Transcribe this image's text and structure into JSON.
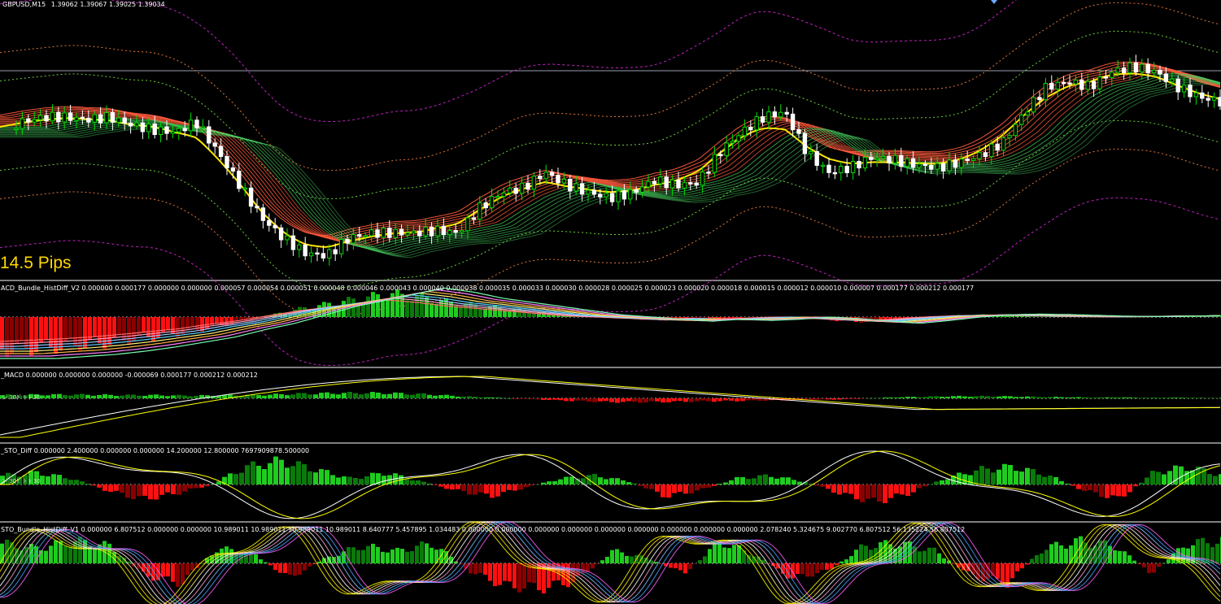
{
  "window": {
    "symbol_header": "GBPUSD,M15",
    "ohlc": "1.39062 1.39067 1.39025 1.39034",
    "pips_label": "14.5 Pips"
  },
  "panes": {
    "p1": {
      "header": "ACD_Bundle_HistDiff_V2 0.000000 0.000177 0.000000 0.000000 0.000057 0.000054 0.000051 0.000048 0.000046 0.000043 0.000040 0.000038 0.000035 0.000033 0.000030 0.000028 0.000025 0.000023 0.000020 0.000018 0.000015 0.000012 0.000010 0.000007 0.000177 0.000212 0.000177"
    },
    "p2": {
      "header": "_MACD 0.000000 0.000000 0.000000 -0.000069 0.000177 0.000212 0.000212",
      "level_text": "ン 30ｸﾞ ﾄ ﾄ 30"
    },
    "p3": {
      "header": "_STO_Diff 0.000000 2.400000 0.000000 0.000000 14.200000 12.800000 7697909878.500000",
      "level_text": "ン 30ｸﾞ ﾄ ﾄ 30"
    },
    "p4": {
      "header": "STO_Bundle_HistDiff_V1 0.000000 6.807512 0.000000 0.000000 10.989011 10.989011 10.989011 10.989011 8.640777 5.457895 1.034483 0.000000 0.000000 0.000000 0.000000 0.000000 0.000000 0.000000 0.000000 0.000000 2.078240 5.324675 9.002770 6.807512 56.135224 56.807512"
    }
  },
  "colors": {
    "bull_candle": "#00e000",
    "bear_candle": "#ffffff",
    "bundle_a": "#ff5a3c",
    "bundle_b": "#4cd964",
    "bundle_yellow": "#ffe600",
    "band_outer": "#c020c0",
    "band_mid": "#e0783c",
    "band_inner": "#6ccf3c",
    "hist_pos": "#1fcc1f",
    "hist_pos_dark": "#0a7a0a",
    "hist_neg": "#ff1010",
    "hist_neg_dark": "#8a0000",
    "macd_line": "#ffffff",
    "signal_line": "#ffff00",
    "separator": "#808080"
  },
  "chart_data": [
    {
      "type": "line",
      "pane": "price",
      "title": "GBPUSD,M15",
      "description_series": [
        {
          "values": [
            0.55,
            0.58,
            0.6,
            0.6,
            0.59,
            0.6,
            0.57,
            0.55,
            0.54,
            0.58,
            0.46,
            0.33,
            0.2,
            0.12,
            0.06,
            0.05,
            0.12,
            0.14,
            0.14,
            0.14,
            0.15,
            0.14,
            0.24,
            0.3,
            0.32,
            0.38,
            0.33,
            0.3,
            0.28,
            0.3,
            0.35,
            0.33,
            0.34,
            0.46,
            0.54,
            0.6,
            0.62,
            0.46,
            0.38,
            0.4,
            0.44,
            0.43,
            0.41,
            0.4,
            0.42,
            0.45,
            0.5,
            0.62,
            0.72,
            0.74,
            0.72,
            0.78,
            0.8,
            0.78,
            0.72,
            0.68,
            0.66
          ]
        }
      ]
    },
    {
      "type": "bar",
      "pane": "macd_bundle",
      "values": [
        -1,
        -0.95,
        -0.9,
        -0.82,
        -0.72,
        -0.6,
        -0.48,
        -0.3,
        -0.15,
        0.05,
        0.25,
        0.4,
        0.55,
        0.7,
        0.6,
        0.45,
        0.35,
        0.25,
        0.15,
        0.05,
        0.0,
        -0.05,
        -0.1,
        -0.05,
        -0.08,
        -0.05,
        0.0,
        -0.04,
        -0.1,
        -0.15,
        -0.08,
        0.0,
        0.05,
        0.07,
        0.06,
        0.04,
        0.02,
        0.01,
        0.02,
        0.03,
        0.04,
        0.05
      ]
    },
    {
      "type": "bar",
      "pane": "macd",
      "values": [
        0.3,
        0.35,
        0.35,
        0.3,
        0.3,
        0.25,
        0.3,
        0.35,
        0.45,
        0.5,
        0.5,
        0.4,
        0.2,
        0.05,
        -0.1,
        -0.25,
        -0.35,
        -0.35,
        -0.3,
        -0.25,
        -0.2,
        -0.15,
        -0.1,
        0.05,
        0.15,
        0.2,
        0.2,
        0.15,
        0.1,
        0.08,
        0.06,
        0.05,
        0.04
      ]
    },
    {
      "type": "bar",
      "pane": "sto_diff",
      "values": [
        0.3,
        0.4,
        0.2,
        -0.2,
        -0.5,
        -0.3,
        0.0,
        0.6,
        0.8,
        0.5,
        0.2,
        0.4,
        0.1,
        -0.2,
        -0.4,
        -0.1,
        0.2,
        0.3,
        0.1,
        -0.4,
        -0.2,
        0.2,
        0.3,
        0.1,
        -0.3,
        -0.6,
        -0.3,
        0.2,
        0.5,
        0.6,
        0.3,
        -0.2,
        -0.5,
        0.4,
        0.6,
        0.3
      ]
    },
    {
      "type": "bar",
      "pane": "sto_bundle",
      "values": [
        0.8,
        0.6,
        0.9,
        0.7,
        -0.5,
        -0.8,
        0.6,
        0.4,
        -0.6,
        0.2,
        0.7,
        0.5,
        0.8,
        -0.3,
        -0.9,
        -1,
        -0.7,
        0.5,
        0.2,
        -0.4,
        0.9,
        0.3,
        -0.6,
        -0.3,
        0.7,
        0.8,
        0.5,
        -0.5,
        -0.8,
        0.6,
        0.9,
        0.7,
        -0.4,
        0.8,
        0.9
      ]
    }
  ]
}
